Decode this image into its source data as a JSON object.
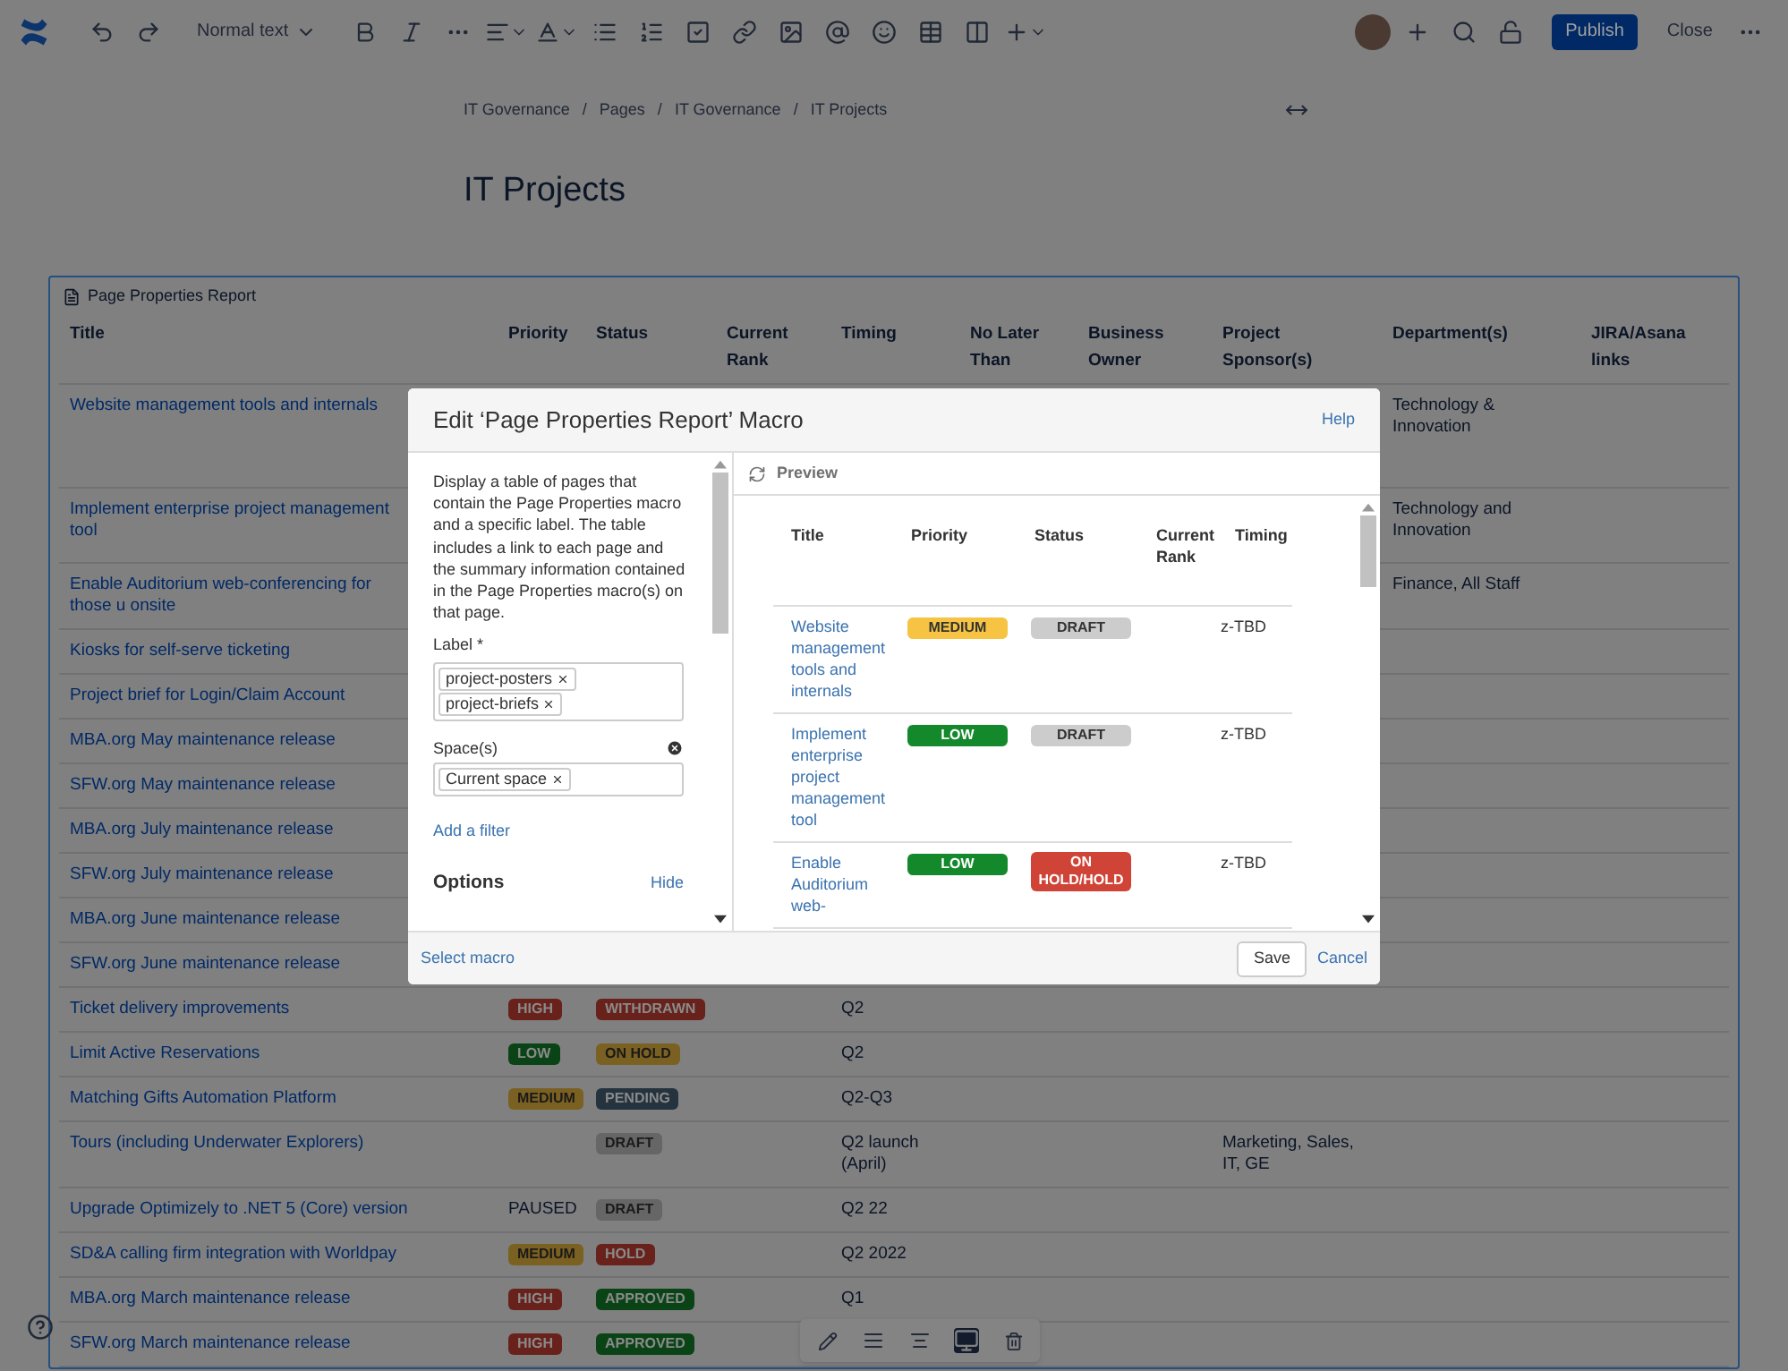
{
  "toolbar": {
    "text_style": "Normal text",
    "publish": "Publish",
    "close": "Close"
  },
  "breadcrumbs": [
    "IT Governance",
    "Pages",
    "IT Governance",
    "IT Projects"
  ],
  "breadcrumb_separator": "/",
  "page_title": "IT Projects",
  "report": {
    "title": "Page Properties Report",
    "columns": [
      "Title",
      "Priority",
      "Status",
      "Current Rank",
      "Timing",
      "No Later Than",
      "Business Owner",
      "Project Sponsor(s)",
      "Department(s)",
      "JIRA/Asana links"
    ],
    "rows": [
      {
        "title": "Website management tools and internals",
        "department": "Technology & Innovation"
      },
      {
        "title": "Implement enterprise project management tool",
        "department": "Technology and Innovation"
      },
      {
        "title": "Enable Auditorium web-conferencing for those u onsite",
        "department": "Finance, All Staff"
      },
      {
        "title": "Kiosks for self-serve ticketing"
      },
      {
        "title": "Project brief for Login/Claim Account"
      },
      {
        "title": "MBA.org May maintenance release"
      },
      {
        "title": "SFW.org May maintenance release"
      },
      {
        "title": "MBA.org July maintenance release"
      },
      {
        "title": "SFW.org July maintenance release"
      },
      {
        "title": "MBA.org June maintenance release"
      },
      {
        "title": "SFW.org June maintenance release"
      },
      {
        "title": "Ticket delivery improvements",
        "priority": {
          "text": "HIGH",
          "color": "#68221b"
        },
        "status": {
          "text": "WITHDRAWN",
          "color": "#68221b"
        },
        "timing": "Q2"
      },
      {
        "title": "Limit Active Reservations",
        "priority": {
          "text": "LOW",
          "color": "#0a4416"
        },
        "status": {
          "text": "ON HOLD",
          "color": "#7b6121"
        },
        "timing": "Q2"
      },
      {
        "title": "Matching Gifts Automation Platform",
        "priority": {
          "text": "MEDIUM",
          "color": "#7b6121"
        },
        "status": {
          "text": "PENDING",
          "color": "#25333f"
        },
        "timing": "Q2-Q3"
      },
      {
        "title": "Tours (including Underwater Explorers)",
        "status": {
          "text": "DRAFT",
          "color": "#666666"
        },
        "timing": "Q2 launch (April)",
        "sponsor": "Marketing, Sales, IT, GE"
      },
      {
        "title": "Upgrade Optimizely to .NET 5 (Core) version",
        "priority": {
          "text": "PAUSED"
        },
        "status": {
          "text": "DRAFT",
          "color": "#666666"
        },
        "timing": "Q2 22"
      },
      {
        "title": "SD&A calling firm integration with Worldpay",
        "priority": {
          "text": "MEDIUM",
          "color": "#7b6121"
        },
        "status": {
          "text": "HOLD",
          "color": "#68221b"
        },
        "timing": "Q2 2022"
      },
      {
        "title": "MBA.org March maintenance release",
        "priority": {
          "text": "HIGH",
          "color": "#68221b"
        },
        "status": {
          "text": "APPROVED",
          "color": "#0a4416"
        },
        "timing": "Q1"
      },
      {
        "title": "SFW.org March maintenance release",
        "priority": {
          "text": "HIGH",
          "color": "#68221b"
        },
        "status": {
          "text": "APPROVED",
          "color": "#0a4416"
        }
      }
    ]
  },
  "modal": {
    "title": "Edit ‘Page Properties Report’ Macro",
    "help": "Help",
    "description": "Display a table of pages that contain the Page Properties macro and a specific label. The table includes a link to each page and the summary information contained in the Page Properties macro(s) on that page.",
    "label_field": {
      "label": "Label *",
      "tags": [
        "project-posters",
        "project-briefs"
      ]
    },
    "space_field": {
      "label": "Space(s)",
      "tags": [
        "Current space"
      ]
    },
    "add_filter": "Add a filter",
    "options": "Options",
    "hide": "Hide",
    "preview": {
      "title": "Preview",
      "columns": [
        "Title",
        "Priority",
        "Status",
        "Current Rank",
        "Timing"
      ],
      "rows": [
        {
          "title": "Website management tools and internals",
          "priority": {
            "text": "MEDIUM",
            "color": "#f6c342"
          },
          "status": {
            "text": "DRAFT",
            "color": "#cccccc"
          },
          "timing": "z-TBD"
        },
        {
          "title": "Implement enterprise project management tool",
          "priority": {
            "text": "LOW",
            "color": "#14892c"
          },
          "status": {
            "text": "DRAFT",
            "color": "#cccccc"
          },
          "timing": "z-TBD"
        },
        {
          "title": "Enable Auditorium web-",
          "priority": {
            "text": "LOW",
            "color": "#14892c"
          },
          "status": {
            "text": "ON HOLD/HOLD",
            "color": "#d04437"
          },
          "timing": "z-TBD"
        }
      ]
    },
    "select_macro": "Select macro",
    "save": "Save",
    "cancel": "Cancel"
  }
}
